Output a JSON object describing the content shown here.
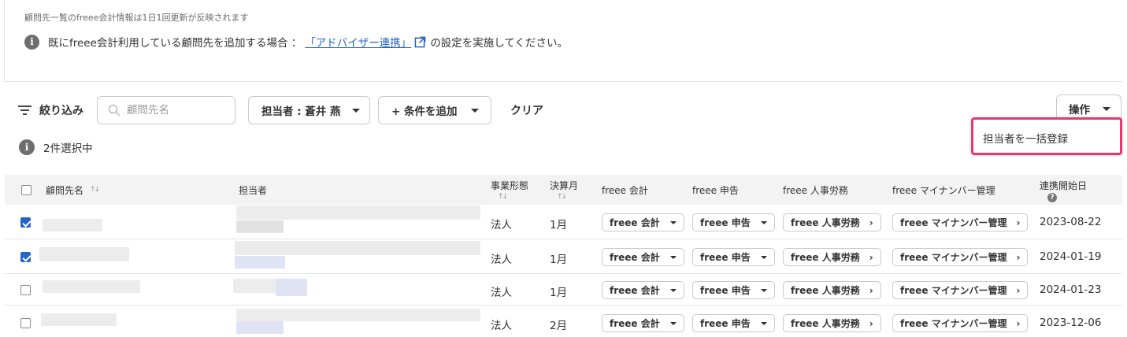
{
  "notice": {
    "update_note": "顧問先一覧のfreee会計情報は1日1回更新が反映されます",
    "info_text_1": "既にfreee会計利用している顧問先を追加する場合 ：",
    "info_link": "「アドバイザー連携」",
    "info_text_2": "の設定を実施してください。"
  },
  "toolbar": {
    "filter_label": "絞り込み",
    "search_placeholder": "顧問先名",
    "assignee_filter_label": "担当者 : 蒼井 燕",
    "add_condition_label": "+ 条件を追加",
    "clear_label": "クリア",
    "operations_label": "操作",
    "operations_menu": [
      "担当者を一括登録"
    ]
  },
  "selection": {
    "text": "2件選択中"
  },
  "table": {
    "headers": {
      "client_name": "顧問先名",
      "assignee": "担当者",
      "business_type": "事業形態",
      "fiscal_month": "決算月",
      "freee_accounting": "freee 会計",
      "freee_tax": "freee 申告",
      "freee_hr": "freee 人事労務",
      "freee_mynumber": "freee マイナンバー管理",
      "start_date": "連携開始日"
    },
    "rows": [
      {
        "checked": true,
        "business_type": "法人",
        "fiscal_month": "1月",
        "accounting": "freee 会計",
        "tax": "freee 申告",
        "hr": "freee 人事労務",
        "mynumber": "freee マイナンバー管理",
        "start_date": "2023-08-22"
      },
      {
        "checked": true,
        "business_type": "法人",
        "fiscal_month": "1月",
        "accounting": "freee 会計",
        "tax": "freee 申告",
        "hr": "freee 人事労務",
        "mynumber": "freee マイナンバー管理",
        "start_date": "2024-01-19"
      },
      {
        "checked": false,
        "business_type": "法人",
        "fiscal_month": "1月",
        "accounting": "freee 会計",
        "tax": "freee 申告",
        "hr": "freee 人事労務",
        "mynumber": "freee マイナンバー管理",
        "start_date": "2024-01-23"
      },
      {
        "checked": false,
        "business_type": "法人",
        "fiscal_month": "2月",
        "accounting": "freee 会計",
        "tax": "freee 申告",
        "hr": "freee 人事労務",
        "mynumber": "freee マイナンバー管理",
        "start_date": "2023-12-06"
      }
    ]
  },
  "colors": {
    "link": "#2864c8",
    "highlight_border": "#e8376a",
    "header_bg": "#f3f3f3"
  }
}
